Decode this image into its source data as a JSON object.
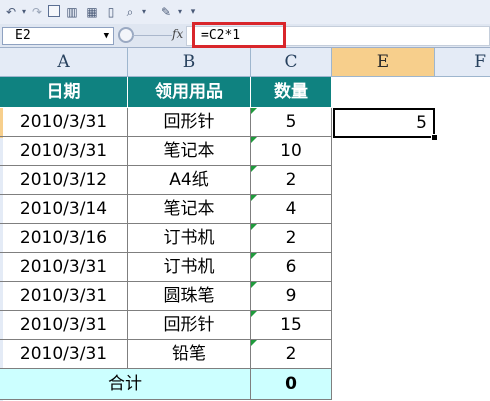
{
  "toolbar": {
    "icons": [
      "undo-icon",
      "redo-icon",
      "form-icon",
      "chart-icon",
      "table-icon",
      "new-doc-icon",
      "print-preview-icon",
      "format-icon",
      "customize-icon"
    ]
  },
  "formula_bar": {
    "name_box": "E2",
    "fx": "fx",
    "formula": "=C2*1"
  },
  "columns": [
    "A",
    "B",
    "C",
    "E",
    "F"
  ],
  "active_column": "E",
  "table": {
    "headers": [
      "日期",
      "领用用品",
      "数量"
    ],
    "rows": [
      [
        "2010/3/31",
        "回形针",
        "5"
      ],
      [
        "2010/3/31",
        "笔记本",
        "10"
      ],
      [
        "2010/3/12",
        "A4纸",
        "2"
      ],
      [
        "2010/3/14",
        "笔记本",
        "4"
      ],
      [
        "2010/3/16",
        "订书机",
        "2"
      ],
      [
        "2010/3/31",
        "订书机",
        "6"
      ],
      [
        "2010/3/31",
        "圆珠笔",
        "9"
      ],
      [
        "2010/3/31",
        "回形针",
        "15"
      ],
      [
        "2010/3/31",
        "铅笔",
        "2"
      ]
    ],
    "total_label": "合计",
    "total_value": "0"
  },
  "selected_cell_value": "5",
  "colors": {
    "header_fill": "#0f8280",
    "total_fill": "#ccffff",
    "highlight_box": "#d9262b",
    "active_column_fill": "#f7cf8c"
  }
}
